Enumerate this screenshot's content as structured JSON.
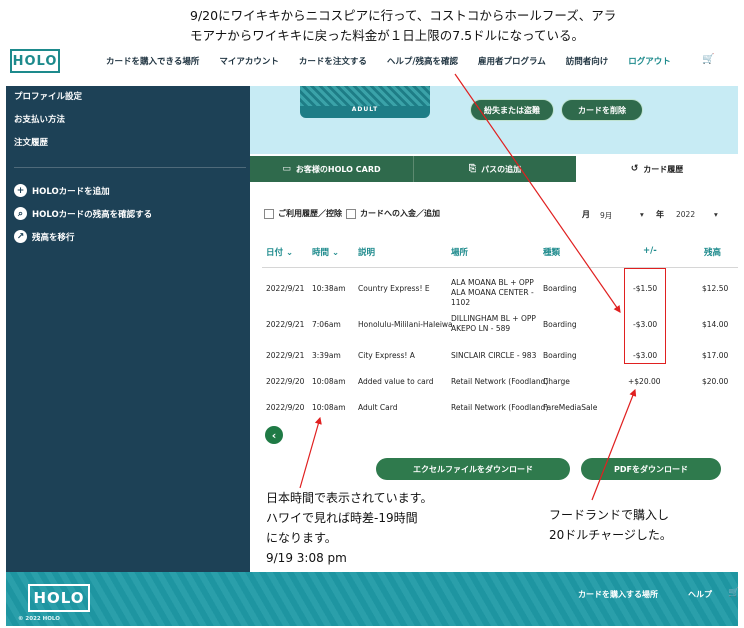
{
  "annotations": {
    "top_line1": "9/20にワイキキからニコスピアに行って、コストコからホールフーズ、アラ",
    "top_line2": "モアナからワイキキに戻った料金が１日上限の7.5ドルになっている。",
    "left_lines": [
      "日本時間で表示されています。",
      "ハワイで見れば時差-19時間",
      "になります。",
      "9/19 3:08 pm"
    ],
    "right_lines": [
      "フードランドで購入し",
      "20ドルチャージした。"
    ],
    "highlight_color": "#e02020"
  },
  "header": {
    "logo": "HOLO",
    "nav": [
      "カードを購入できる場所",
      "マイアカウント",
      "カードを注文する",
      "ヘルプ/残高を確認",
      "雇用者プログラム",
      "訪問者向け",
      "ログアウト"
    ],
    "cart_icon": "cart-icon"
  },
  "sidebar": {
    "items": [
      "プロファイル設定",
      "お支払い方法",
      "注文履歴"
    ],
    "actions": [
      {
        "icon": "plus-icon",
        "label": "HOLOカードを追加"
      },
      {
        "icon": "search-icon",
        "label": "HOLOカードの残高を確認する"
      },
      {
        "icon": "transfer-icon",
        "label": "残高を移行"
      }
    ]
  },
  "card": {
    "label": "ADULT",
    "lost_button": "紛失または盗難",
    "delete_button": "カードを削除"
  },
  "tabs": [
    "お客様のHOLO CARD",
    "パスの追加",
    "カード履歴"
  ],
  "filters": {
    "usage_check": "ご利用履歴／控除",
    "deposit_check": "カードへの入金／追加",
    "month_label": "月",
    "month_value": "9月",
    "year_label": "年",
    "year_value": "2022"
  },
  "table": {
    "headers": [
      "日付",
      "時間",
      "説明",
      "場所",
      "種類",
      "+/-",
      "残高"
    ],
    "rows": [
      {
        "date": "2022/9/21",
        "time": "10:38am",
        "desc": "Country Express! E",
        "place": "ALA MOANA BL + OPP ALA MOANA CENTER - 1102",
        "type": "Boarding",
        "amount": "-$1.50",
        "balance": "$12.50"
      },
      {
        "date": "2022/9/21",
        "time": "7:06am",
        "desc": "Honolulu-Mililani-Haleiwa",
        "place": "DILLINGHAM BL + OPP AKEPO LN - 589",
        "type": "Boarding",
        "amount": "-$3.00",
        "balance": "$14.00"
      },
      {
        "date": "2022/9/21",
        "time": "3:39am",
        "desc": "City Express! A",
        "place": "SINCLAIR CIRCLE - 983",
        "type": "Boarding",
        "amount": "-$3.00",
        "balance": "$17.00"
      },
      {
        "date": "2022/9/20",
        "time": "10:08am",
        "desc": "Added value to card",
        "place": "Retail Network (Foodland)",
        "type": "Charge",
        "amount": "+$20.00",
        "balance": "$20.00"
      },
      {
        "date": "2022/9/20",
        "time": "10:08am",
        "desc": "Adult Card",
        "place": "Retail Network (Foodland)",
        "type": "FareMediaSale",
        "amount": "",
        "balance": ""
      }
    ]
  },
  "buttons": {
    "excel": "エクセルファイルをダウンロード",
    "pdf": "PDFをダウンロード"
  },
  "footer": {
    "logo": "HOLO",
    "copyright": "© 2022 HOLO",
    "nav": [
      "カードを購入する場所",
      "ヘルプ"
    ]
  },
  "colors": {
    "sidebar": "#1d4156",
    "accent": "#1d8a8c",
    "button_green": "#2f6a4c",
    "footer": "#1f9aa6"
  }
}
